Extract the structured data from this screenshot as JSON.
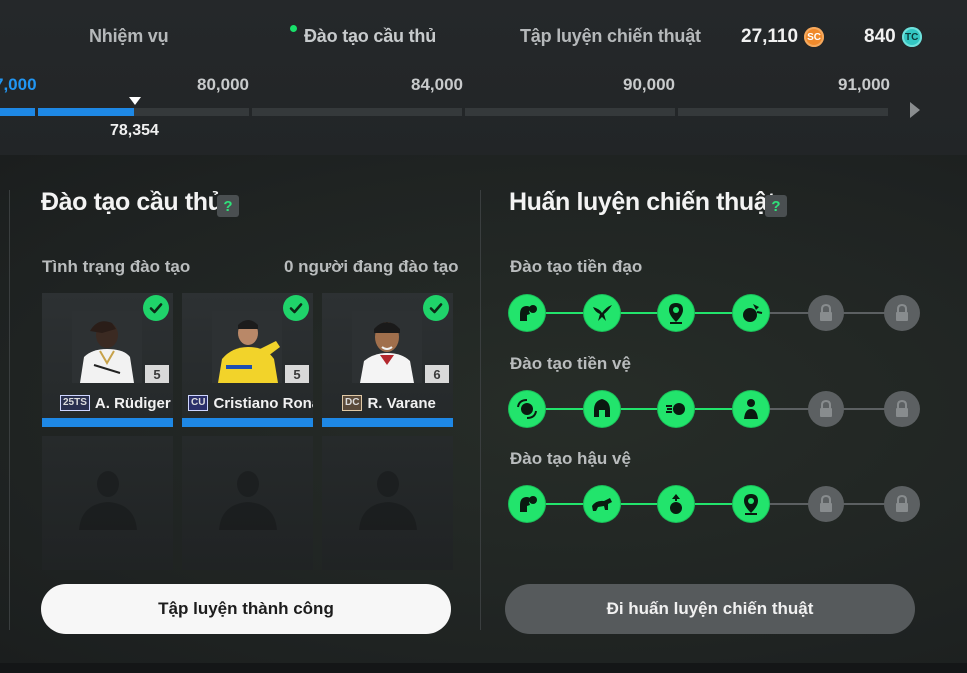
{
  "tabs": [
    {
      "label": "Nhiệm vụ"
    },
    {
      "label": "Đào tạo cầu thủ"
    },
    {
      "label": "Tập luyện chiến thuật"
    }
  ],
  "currency": {
    "sc": {
      "value": "27,110",
      "icon": "SC"
    },
    "tc": {
      "value": "840",
      "icon": "TC"
    }
  },
  "progress": {
    "current_label": "7,000",
    "milestones": [
      "80,000",
      "84,000",
      "90,000",
      "91,000"
    ],
    "value": "78,354"
  },
  "player_training": {
    "title": "Đào tạo cầu thủ",
    "help": "?",
    "status_label": "Tình trạng đào tạo",
    "status_count": "0 người đang đào tạo",
    "players": [
      {
        "name": "A. Rüdiger",
        "badge": "25TS",
        "level": "5"
      },
      {
        "name": "Cristiano Ronaldo",
        "badge": "CU",
        "level": "5"
      },
      {
        "name": "R. Varane",
        "badge": "DC",
        "level": "6"
      }
    ],
    "button": "Tập luyện thành công"
  },
  "tactic_training": {
    "title": "Huấn luyện chiến thuật",
    "help": "?",
    "rows": [
      {
        "label": "Đào tạo tiền đạo"
      },
      {
        "label": "Đào tạo tiền vệ"
      },
      {
        "label": "Đào tạo hậu vệ"
      }
    ],
    "button": "Đi huấn luyện chiến thuật"
  },
  "colors": {
    "accent_green": "#22e46c",
    "progress_blue": "#1e88e5"
  }
}
